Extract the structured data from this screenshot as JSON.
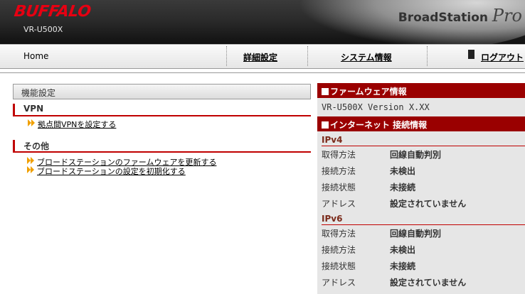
{
  "header": {
    "brand": "BUFFALO",
    "model": "VR-U500X",
    "product_name": "BroadStation",
    "product_suffix": "Pro"
  },
  "nav": {
    "home": "Home",
    "advanced": "詳細設定",
    "system_info": "システム情報",
    "logout": "ログアウト"
  },
  "left": {
    "title": "機能設定",
    "sections": [
      {
        "label": "VPN",
        "links": [
          "拠点間VPNを設定する"
        ]
      },
      {
        "label": "その他",
        "links": [
          "ブロードステーションのファームウェアを更新する",
          "ブロードステーションの設定を初期化する"
        ]
      }
    ]
  },
  "right": {
    "firmware_header": "ファームウェア情報",
    "firmware_text": "VR-U500X Version X.XX",
    "internet_header": "インターネット 接続情報",
    "ipv4": {
      "label": "IPv4",
      "rows": [
        {
          "key": "取得方法",
          "value": "回線自動判別"
        },
        {
          "key": "接続方法",
          "value": "未検出"
        },
        {
          "key": "接続状態",
          "value": "未接続"
        },
        {
          "key": "アドレス",
          "value": "設定されていません"
        }
      ]
    },
    "ipv6": {
      "label": "IPv6",
      "rows": [
        {
          "key": "取得方法",
          "value": "回線自動判別"
        },
        {
          "key": "接続方法",
          "value": "未検出"
        },
        {
          "key": "接続状態",
          "value": "未接続"
        },
        {
          "key": "アドレス",
          "value": "設定されていません"
        }
      ]
    }
  },
  "colors": {
    "accent_red": "#9a0000",
    "brand_red": "#e60012",
    "panel_gray": "#e6e6e6"
  }
}
